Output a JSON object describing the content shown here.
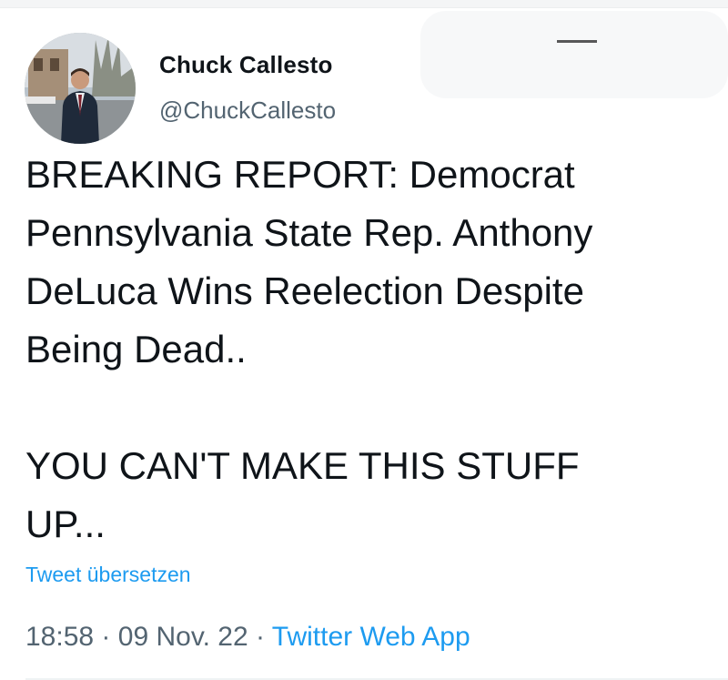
{
  "tweet": {
    "author": {
      "display_name": "Chuck Callesto",
      "handle": "@ChuckCallesto",
      "avatar": "profile-photo"
    },
    "text": "BREAKING REPORT: Democrat\nPennsylvania State Rep. Anthony\nDeLuca Wins Reelection Despite\nBeing Dead..\n\nYOU CAN'T MAKE THIS STUFF\nUP...",
    "translate_label": "Tweet übersetzen",
    "time": "18:58",
    "separator": "·",
    "date": "09 Nov. 22",
    "source": "Twitter Web App"
  },
  "colors": {
    "text": "#0f1419",
    "secondary": "#536471",
    "link": "#1d9bf0",
    "background": "#ffffff"
  }
}
